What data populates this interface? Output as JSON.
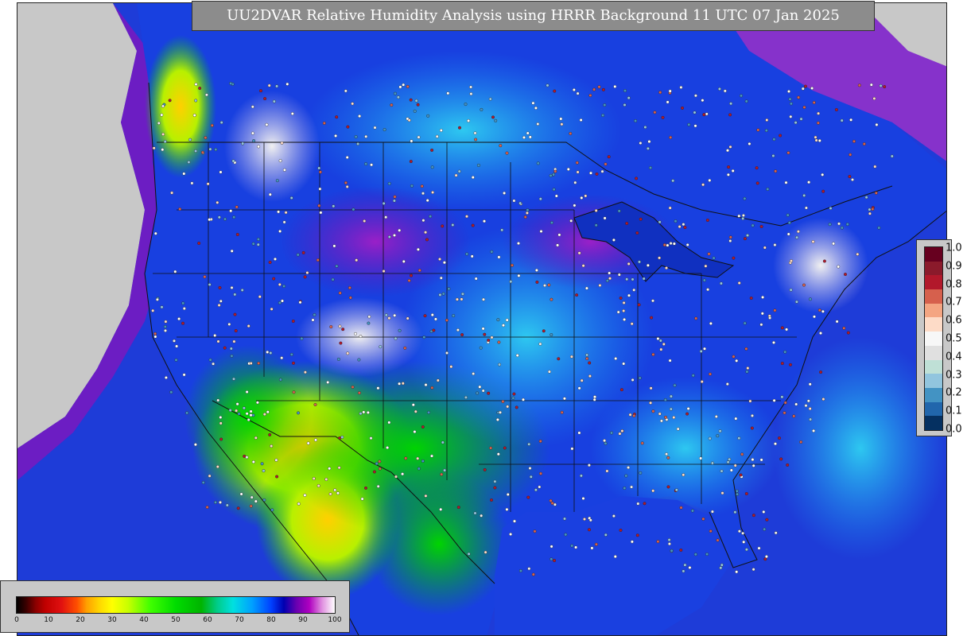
{
  "title": "UU2DVAR Relative Humidity Analysis using HRRR Background 11 UTC 07 Jan 2025",
  "obs_legend": {
    "ticks": [
      "1.0",
      "0.9",
      "0.8",
      "0.7",
      "0.6",
      "0.5",
      "0.4",
      "0.3",
      "0.2",
      "0.1",
      "0.0"
    ],
    "colors": [
      "#67001f",
      "#8b1a2b",
      "#b2182b",
      "#d6604d",
      "#f4a582",
      "#fddbc7",
      "#f7f7f7",
      "#e0e0e0",
      "#bfe0d6",
      "#92c5de",
      "#4393c3",
      "#2166ac",
      "#053061"
    ]
  },
  "rh_legend": {
    "ticks": [
      "0",
      "10",
      "20",
      "30",
      "40",
      "50",
      "60",
      "70",
      "80",
      "90",
      "100"
    ]
  },
  "colors": {
    "ocean": "#1e3cd8",
    "land_outline": "#111111",
    "panel_bg": "#c8c8c8",
    "title_bg": "#8c8c8c"
  }
}
